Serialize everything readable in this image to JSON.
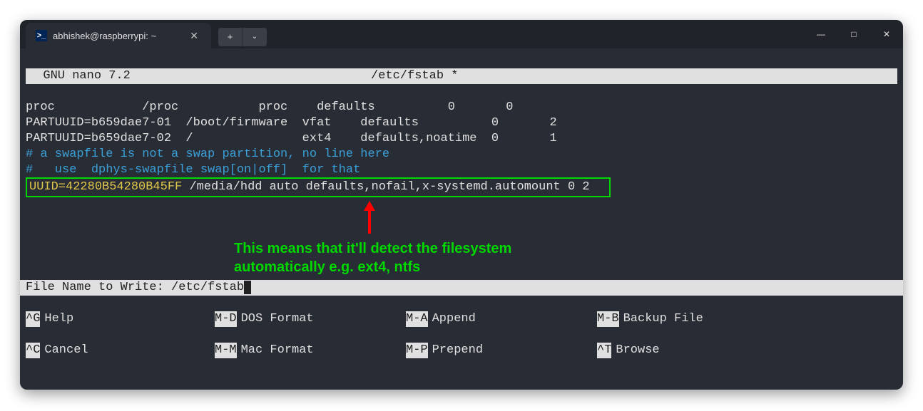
{
  "titlebar": {
    "tab_title": "abhishek@raspberrypi: ~",
    "tab_icon_glyph": ">_",
    "close_glyph": "✕",
    "add_glyph": "+",
    "drop_glyph": "⌄",
    "minimize_glyph": "—",
    "maximize_glyph": "□",
    "win_close_glyph": "✕"
  },
  "nano": {
    "app": "  GNU nano 7.2",
    "file": "/etc/fstab *"
  },
  "content": {
    "line1": "proc            /proc           proc    defaults          0       0",
    "line2": "PARTUUID=b659dae7-01  /boot/firmware  vfat    defaults          0       2",
    "line3": "PARTUUID=b659dae7-02  /               ext4    defaults,noatime  0       1",
    "line4": "# a swapfile is not a swap partition, no line here",
    "line5": "#   use  dphys-swapfile swap[on|off]  for that",
    "hl_uuid": "UUID=42280B54280B45FF",
    "hl_rest": " /media/hdd auto defaults,nofail,x-systemd.automount 0 2"
  },
  "annotation": {
    "line1": "This means that it'll detect the filesystem",
    "line2": "automatically e.g. ext4, ntfs"
  },
  "prompt": {
    "label": "File Name to Write: ",
    "value": "/etc/fstab"
  },
  "shortcuts": {
    "row1": [
      {
        "key": "^G",
        "label": "Help"
      },
      {
        "key": "M-D",
        "label": "DOS Format"
      },
      {
        "key": "M-A",
        "label": "Append"
      },
      {
        "key": "M-B",
        "label": "Backup File"
      }
    ],
    "row2": [
      {
        "key": "^C",
        "label": "Cancel"
      },
      {
        "key": "M-M",
        "label": "Mac Format"
      },
      {
        "key": "M-P",
        "label": "Prepend"
      },
      {
        "key": "^T",
        "label": "Browse"
      }
    ]
  },
  "colors": {
    "highlight_border": "#00d800",
    "arrow": "#ff0000"
  }
}
